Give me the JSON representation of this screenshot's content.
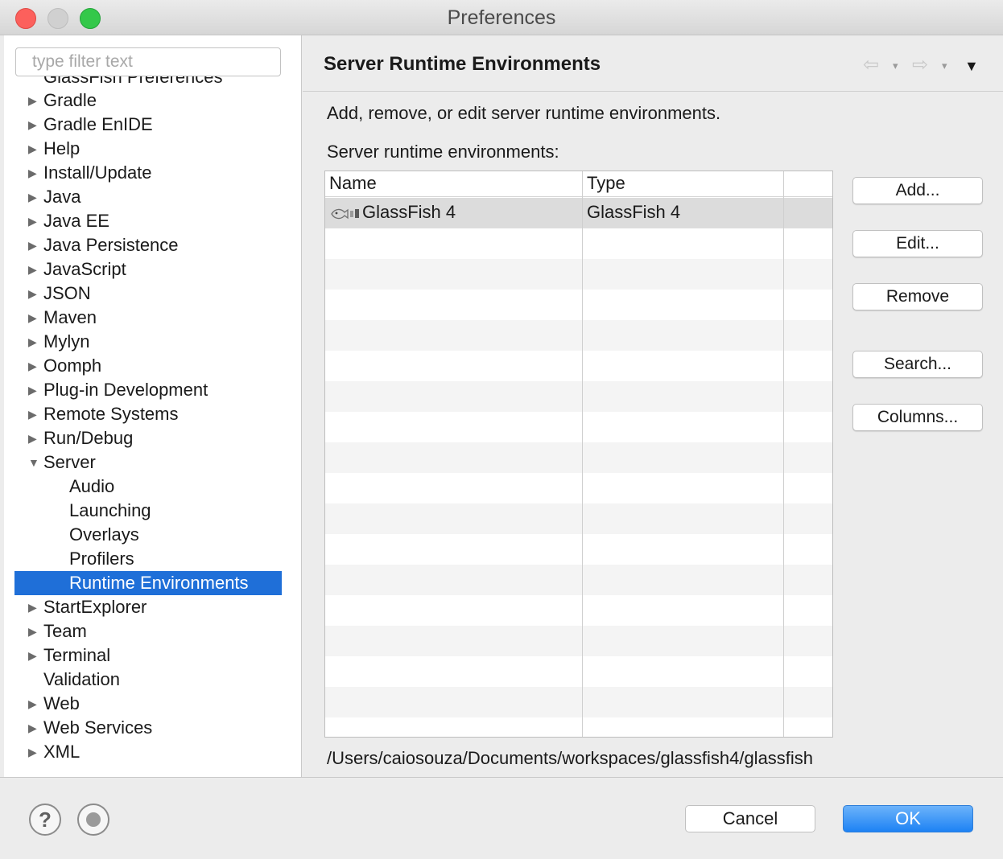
{
  "window": {
    "title": "Preferences"
  },
  "filter": {
    "placeholder": "type filter text"
  },
  "tree": {
    "items": [
      {
        "label": "GlassFish Preferences",
        "arrow": ""
      },
      {
        "label": "Gradle",
        "arrow": "▶"
      },
      {
        "label": "Gradle EnIDE",
        "arrow": "▶"
      },
      {
        "label": "Help",
        "arrow": "▶"
      },
      {
        "label": "Install/Update",
        "arrow": "▶"
      },
      {
        "label": "Java",
        "arrow": "▶"
      },
      {
        "label": "Java EE",
        "arrow": "▶"
      },
      {
        "label": "Java Persistence",
        "arrow": "▶"
      },
      {
        "label": "JavaScript",
        "arrow": "▶"
      },
      {
        "label": "JSON",
        "arrow": "▶"
      },
      {
        "label": "Maven",
        "arrow": "▶"
      },
      {
        "label": "Mylyn",
        "arrow": "▶"
      },
      {
        "label": "Oomph",
        "arrow": "▶"
      },
      {
        "label": "Plug-in Development",
        "arrow": "▶"
      },
      {
        "label": "Remote Systems",
        "arrow": "▶"
      },
      {
        "label": "Run/Debug",
        "arrow": "▶"
      },
      {
        "label": "Server",
        "arrow": "▼"
      },
      {
        "label": "Audio"
      },
      {
        "label": "Launching"
      },
      {
        "label": "Overlays"
      },
      {
        "label": "Profilers"
      },
      {
        "label": "Runtime Environments"
      },
      {
        "label": "StartExplorer",
        "arrow": "▶"
      },
      {
        "label": "Team",
        "arrow": "▶"
      },
      {
        "label": "Terminal",
        "arrow": "▶"
      },
      {
        "label": "Validation",
        "arrow": ""
      },
      {
        "label": "Web",
        "arrow": "▶"
      },
      {
        "label": "Web Services",
        "arrow": "▶"
      },
      {
        "label": "XML",
        "arrow": "▶"
      }
    ]
  },
  "page": {
    "title": "Server Runtime Environments",
    "description": "Add, remove, or edit server runtime environments.",
    "list_label": "Server runtime environments:",
    "nav": {
      "back": "⇦",
      "forward": "⇨",
      "dropdown": "▾",
      "menu": "▼"
    }
  },
  "table": {
    "headers": {
      "name": "Name",
      "type": "Type"
    },
    "rows": [
      {
        "name": "GlassFish 4",
        "type": "GlassFish 4"
      }
    ]
  },
  "buttons": {
    "add": "Add...",
    "edit": "Edit...",
    "remove": "Remove",
    "search": "Search...",
    "columns": "Columns..."
  },
  "path": "/Users/caiosouza/Documents/workspaces/glassfish4/glassfish",
  "footer": {
    "help": "?",
    "cancel": "Cancel",
    "ok": "OK"
  }
}
